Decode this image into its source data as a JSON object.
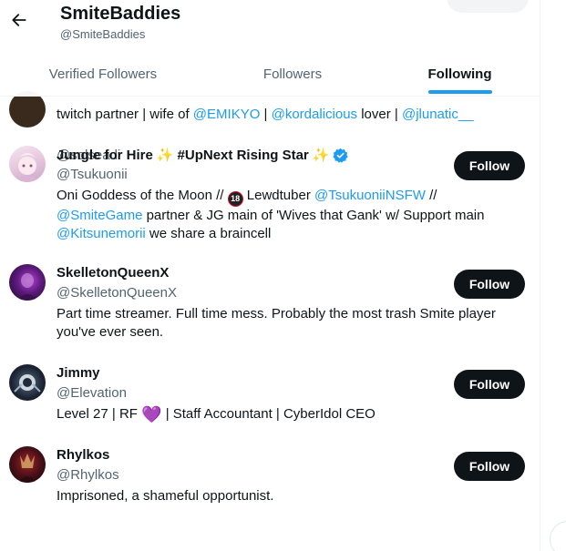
{
  "header": {
    "title": "SmiteBaddies",
    "handle": "@SmiteBaddies"
  },
  "tabs": [
    {
      "label": "Verified Followers",
      "active": false
    },
    {
      "label": "Followers",
      "active": false
    },
    {
      "label": "Following",
      "active": true
    }
  ],
  "partial_row": {
    "handle": "@solseadi",
    "bio_parts": [
      "twitch partner | wife of ",
      "@EMIKYO",
      " | ",
      "@kordalicious",
      " lover | ",
      "@jlunatic__"
    ]
  },
  "users": [
    {
      "name_a": "Jungle for Hire",
      "name_b": "#UpNext Rising Star",
      "sparkle": "✨",
      "handle": "@Tsukuonii",
      "bio": {
        "p1": "Oni Goddess of the Moon // ",
        "badge": "18",
        "p2": " Lewdtuber ",
        "m1": "@TsukuoniiNSFW",
        "p3": " //",
        "m2": "@SmiteGame",
        "p4": " partner & JG main of 'Wives that Gank' w/ Support main",
        "m3": "@Kitsunemorii",
        "p5": " we share a braincell"
      },
      "button": "Follow"
    },
    {
      "name": "SkelletonQueenX",
      "handle": "@SkelletonQueenX",
      "bio_line1": "Part time streamer. Full time mess. Probably the most trash Smite player",
      "bio_line2": "you've ever seen.",
      "button": "Follow"
    },
    {
      "name": "Jimmy",
      "handle": "@Elevation",
      "bio_p1": "Level 27 | RF ",
      "heart": "💜",
      "bio_p2": " | Staff Accountant | CyberIdol CEO",
      "button": "Follow"
    },
    {
      "name": "Rhylkos",
      "handle": "@Rhylkos",
      "bio": "Imprisoned, a shameful opportunist.",
      "button": "Follow"
    }
  ],
  "colors": {
    "accent": "#1d9bf0",
    "text": "#0f1419",
    "secondary": "#536471",
    "button_bg": "#0f1419"
  }
}
